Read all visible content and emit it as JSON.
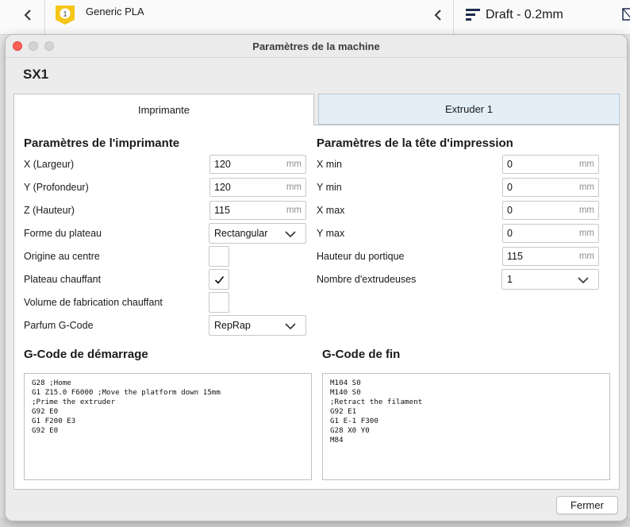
{
  "topbar": {
    "material_badge": "1",
    "material_name": "Generic PLA",
    "profile_name": "Draft - 0.2mm"
  },
  "dialog": {
    "title": "Paramètres de la machine",
    "machine_name": "SX1",
    "tabs": [
      {
        "label": "Imprimante",
        "active": true
      },
      {
        "label": "Extruder 1",
        "active": false
      }
    ],
    "printer": {
      "title": "Paramètres de l'imprimante",
      "x_label": "X (Largeur)",
      "x_value": "120",
      "x_unit": "mm",
      "y_label": "Y (Profondeur)",
      "y_value": "120",
      "y_unit": "mm",
      "z_label": "Z (Hauteur)",
      "z_value": "115",
      "z_unit": "mm",
      "bed_shape_label": "Forme du plateau",
      "bed_shape_value": "Rectangular",
      "origin_center_label": "Origine au centre",
      "origin_center_checked": false,
      "heated_bed_label": "Plateau chauffant",
      "heated_bed_checked": true,
      "heated_volume_label": "Volume de fabrication chauffant",
      "heated_volume_checked": false,
      "gcode_flavor_label": "Parfum G-Code",
      "gcode_flavor_value": "RepRap"
    },
    "printhead": {
      "title": "Paramètres de la tête d'impression",
      "xmin_label": "X min",
      "xmin_value": "0",
      "xmin_unit": "mm",
      "ymin_label": "Y min",
      "ymin_value": "0",
      "ymin_unit": "mm",
      "xmax_label": "X max",
      "xmax_value": "0",
      "xmax_unit": "mm",
      "ymax_label": "Y max",
      "ymax_value": "0",
      "ymax_unit": "mm",
      "gantry_label": "Hauteur du portique",
      "gantry_value": "115",
      "gantry_unit": "mm",
      "extruders_label": "Nombre d'extrudeuses",
      "extruders_value": "1"
    },
    "start_gcode": {
      "title": "G-Code de démarrage",
      "text": "G28 ;Home\nG1 Z15.0 F6000 ;Move the platform down 15mm\n;Prime the extruder\nG92 E0\nG1 F200 E3\nG92 E0"
    },
    "end_gcode": {
      "title": "G-Code de fin",
      "text": "M104 S0\nM140 S0\n;Retract the filament\nG92 E1\nG1 E-1 F300\nG28 X0 Y0\nM84"
    },
    "close_button": "Fermer"
  }
}
